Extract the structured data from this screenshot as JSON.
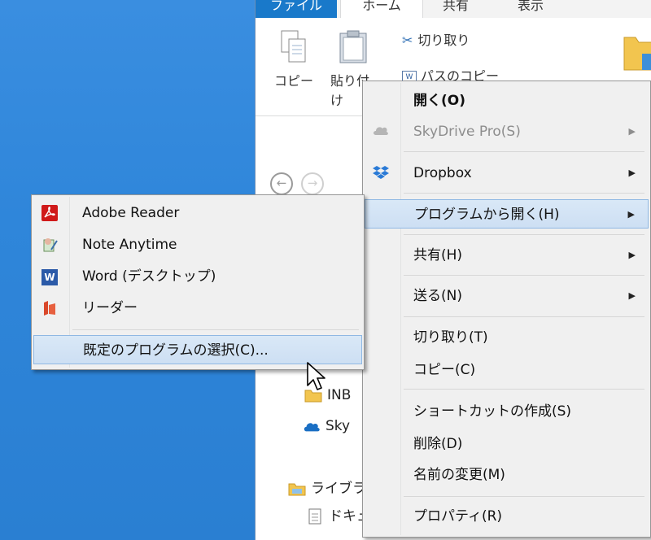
{
  "explorer": {
    "tabs": [
      "ファイル",
      "ホーム",
      "共有",
      "表示"
    ],
    "ribbon": {
      "copy_label": "コピー",
      "paste_label": "貼り付け",
      "cut_label": "切り取り",
      "copy_path_label": "パスのコピー"
    },
    "tree": {
      "inbox": "INB",
      "skydrive": "Sky",
      "library": "ライブラ",
      "documents": "ドキュ"
    }
  },
  "context_menu": {
    "items": [
      {
        "label": "開く(O)",
        "icon": "none",
        "bold": true
      },
      {
        "label": "SkyDrive Pro(S)",
        "icon": "cloud-icon",
        "disabled": true,
        "submenu": true
      },
      {
        "label": "Dropbox",
        "icon": "dropbox-icon",
        "submenu": true
      },
      {
        "label": "プログラムから開く(H)",
        "submenu": true,
        "highlighted": true
      },
      {
        "label": "共有(H)",
        "submenu": true
      },
      {
        "label": "送る(N)",
        "submenu": true
      },
      {
        "label": "切り取り(T)"
      },
      {
        "label": "コピー(C)"
      },
      {
        "label": "ショートカットの作成(S)"
      },
      {
        "label": "削除(D)"
      },
      {
        "label": "名前の変更(M)"
      },
      {
        "label": "プロパティ(R)"
      }
    ]
  },
  "open_with_menu": {
    "items": [
      {
        "label": "Adobe Reader",
        "icon": "adobe-reader-icon"
      },
      {
        "label": "Note Anytime",
        "icon": "note-anytime-icon"
      },
      {
        "label": "Word (デスクトップ)",
        "icon": "word-icon"
      },
      {
        "label": "リーダー",
        "icon": "reader-icon"
      },
      {
        "label": "既定のプログラムの選択(C)...",
        "highlighted": true
      }
    ]
  },
  "colors": {
    "desktop": "#2c85d6",
    "menu_bg": "#f0f0f0",
    "highlight": "#cddff3",
    "highlight_border": "#8fb8e3",
    "file_tab": "#1979ca"
  }
}
